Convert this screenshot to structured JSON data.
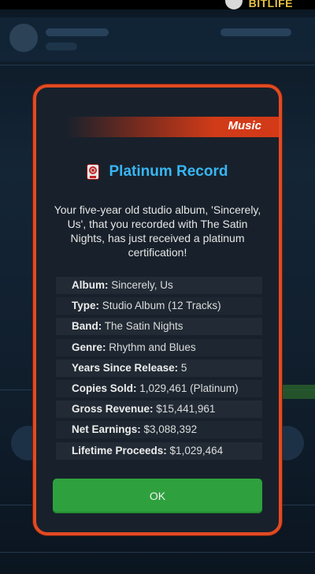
{
  "app": {
    "logo": "BITLIFE"
  },
  "modal": {
    "category": "Music",
    "icon": "record-icon",
    "title": "Platinum Record",
    "description": "Your five-year old studio album, 'Sincerely, Us', that you recorded with The Satin Nights, has just received a platinum certification!",
    "details": [
      {
        "key": "Album:",
        "value": " Sincerely, Us"
      },
      {
        "key": "Type:",
        "value": " Studio Album (12 Tracks)"
      },
      {
        "key": "Band:",
        "value": " The Satin Nights"
      },
      {
        "key": "Genre:",
        "value": " Rhythm and Blues"
      },
      {
        "key": "Years Since Release:",
        "value": " 5"
      },
      {
        "key": "Copies Sold:",
        "value": " 1,029,461 (Platinum)"
      },
      {
        "key": "Gross Revenue:",
        "value": " $15,441,961"
      },
      {
        "key": "Net Earnings:",
        "value": " $3,088,392"
      },
      {
        "key": "Lifetime Proceeds:",
        "value": " $1,029,464"
      }
    ],
    "ok_label": "OK"
  },
  "colors": {
    "accent_border": "#e24a23",
    "title_blue": "#38b6f4",
    "ok_green": "#2ea13e"
  }
}
